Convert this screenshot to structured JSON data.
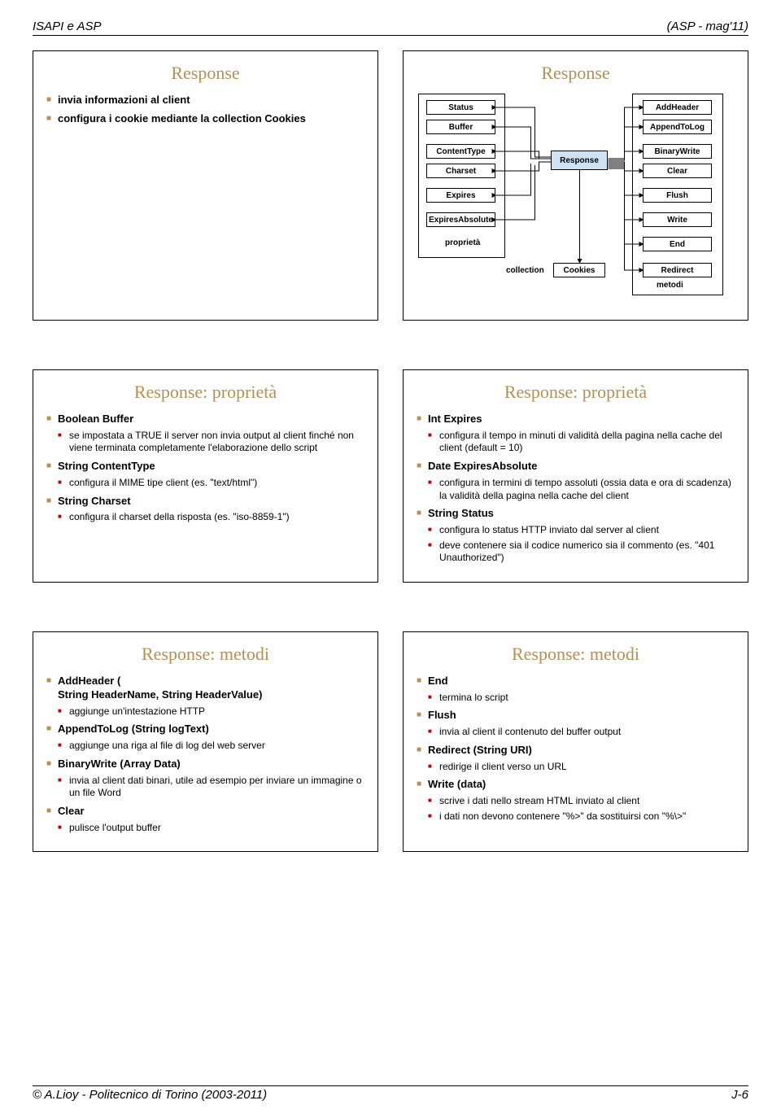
{
  "header": {
    "left": "ISAPI e ASP",
    "right": "(ASP - mag'11)"
  },
  "footer": {
    "left": "© A.Lioy - Politecnico di Torino (2003-2011)",
    "right": "J-6"
  },
  "s1": {
    "title": "Response",
    "i1": "invia informazioni al client",
    "i2": "configura i cookie mediante la collection Cookies"
  },
  "s2": {
    "title": "Response",
    "props": {
      "p1": "Status",
      "p2": "Buffer",
      "p3": "ContentType",
      "p4": "Charset",
      "p5": "Expires",
      "p6": "ExpiresAbsolute",
      "label": "proprietà"
    },
    "meths": {
      "m1": "AddHeader",
      "m2": "AppendToLog",
      "m3": "BinaryWrite",
      "m4": "Clear",
      "m5": "Flush",
      "m6": "Write",
      "m7": "End",
      "m8": "Redirect",
      "label": "metodi"
    },
    "center": "Response",
    "coll": {
      "label": "collection",
      "item": "Cookies"
    }
  },
  "s3": {
    "title": "Response: proprietà",
    "i1": "Boolean Buffer",
    "i1a": "se impostata a TRUE il server non invia output al client finché non viene terminata completamente l'elaborazione dello script",
    "i2": "String ContentType",
    "i2a": "configura il MIME tipe client (es. \"text/html\")",
    "i3": "String Charset",
    "i3a": "configura il charset della risposta (es. \"iso-8859-1\")"
  },
  "s4": {
    "title": "Response: proprietà",
    "i1": "Int Expires",
    "i1a": "configura il tempo in minuti di validità della pagina nella cache del client (default = 10)",
    "i2": "Date ExpiresAbsolute",
    "i2a": "configura in termini di tempo assoluti (ossia data e ora di scadenza) la validità della pagina nella cache del client",
    "i3": "String Status",
    "i3a": "configura lo status HTTP inviato dal server al client",
    "i3b": "deve contenere sia il codice numerico sia il commento (es. \"401 Unauthorized\")"
  },
  "s5": {
    "title": "Response: metodi",
    "i1": "AddHeader (\nString HeaderName, String HeaderValue)",
    "i1a": "aggiunge un'intestazione HTTP",
    "i2": "AppendToLog (String logText)",
    "i2a": "aggiunge una riga al file di log del web server",
    "i3": "BinaryWrite (Array Data)",
    "i3a": "invia al client dati binari, utile ad esempio per inviare un immagine o un file Word",
    "i4": "Clear",
    "i4a": "pulisce l'output buffer"
  },
  "s6": {
    "title": "Response: metodi",
    "i1": "End",
    "i1a": "termina lo script",
    "i2": "Flush",
    "i2a": "invia al client il contenuto del buffer output",
    "i3": "Redirect (String URI)",
    "i3a": "redirige il client verso un URL",
    "i4": "Write (data)",
    "i4a": "scrive i dati nello stream HTML inviato al client",
    "i4b": "i dati non devono contenere \"%>\" da sostituirsi con \"%\\>\""
  }
}
